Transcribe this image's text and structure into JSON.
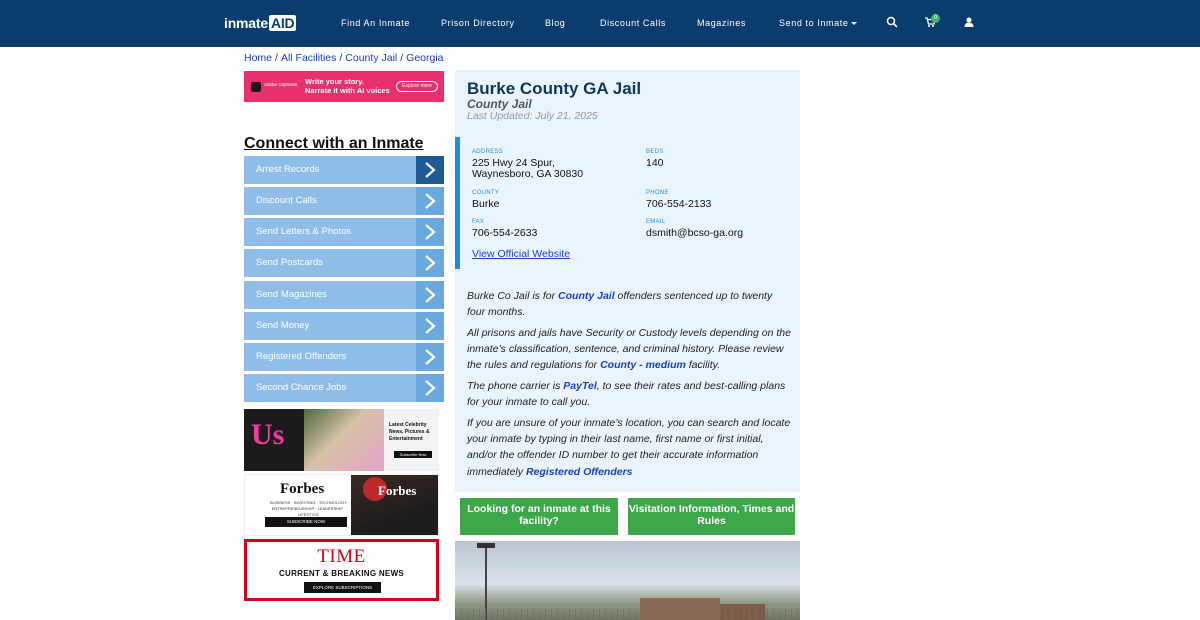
{
  "nav": {
    "logo_main": "inmate",
    "logo_accent": "AID",
    "links": [
      "Find An Inmate",
      "Prison Directory",
      "Blog",
      "Discount Calls",
      "Magazines",
      "Send to Inmate"
    ],
    "cart_count": "0",
    "icons": [
      "search-icon",
      "cart-icon",
      "user-icon"
    ]
  },
  "breadcrumb": [
    "Home",
    "All Facilities",
    "County Jail",
    "Georgia"
  ],
  "ads": {
    "adobe": {
      "brand": "Adobe Captivate",
      "line1": "Write your story.",
      "line2": "Narrate it with AI voices",
      "cta": "Explore more"
    },
    "us": {
      "logo": "Us",
      "text": "Latest Celebrity News, Pictures & Entertainment",
      "cta": "Subscribe Now"
    },
    "forbes": {
      "logo": "Forbes",
      "tagline": "BUSINESS · INVESTING · TECHNOLOGY ENTREPRENEURSHIP · LEADERSHIP · LIFESTYLE",
      "cta": "SUBSCRIBE NOW",
      "cover_logo": "Forbes"
    },
    "time": {
      "logo": "TIME",
      "subtitle": "CURRENT & BREAKING NEWS",
      "cta": "EXPLORE SUBSCRIPTIONS"
    }
  },
  "sidebar": {
    "title": "Connect with an Inmate",
    "items": [
      "Arrest Records",
      "Discount Calls",
      "Send Letters & Photos",
      "Send Postcards",
      "Send Magazines",
      "Send Money",
      "Registered Offenders",
      "Second Chance Jobs"
    ]
  },
  "facility": {
    "title": "Burke County GA Jail",
    "type": "County Jail",
    "updated": "Last Updated: July 21, 2025",
    "fields": {
      "address_label": "ADDRESS",
      "address_line1": "225 Hwy 24 Spur,",
      "address_line2": "Waynesboro, GA 30830",
      "beds_label": "BEDS",
      "beds": "140",
      "county_label": "COUNTY",
      "county": "Burke",
      "phone_label": "PHONE",
      "phone": "706-554-2133",
      "fax_label": "FAX",
      "fax": "706-554-2633",
      "email_label": "EMAIL",
      "email": "dsmith@bcso-ga.org"
    },
    "website_link": "View Official Website"
  },
  "description": {
    "p1_a": "Burke Co Jail is for ",
    "p1_link": "County Jail",
    "p1_b": " offenders sentenced up to twenty four months.",
    "p2_a": "All prisons and jails have Security or Custody levels depending on the inmate’s classification, sentence, and criminal history. Please review the rules and regulations for ",
    "p2_link": "County - medium",
    "p2_b": " facility.",
    "p3_a": "The phone carrier is ",
    "p3_link": "PayTel",
    "p3_b": ", to see their rates and best-calling plans for your inmate to call you.",
    "p4_a": "If you are unsure of your inmate’s location, you can search and locate your inmate by typing in their last name, first name or first initial, and/or the offender ID number to get their accurate information immediately ",
    "p4_link": "Registered Offenders"
  },
  "buttons": {
    "find_inmate": "Looking for an inmate at this facility?",
    "visitation": "Visitation Information, Times and Rules"
  },
  "colors": {
    "navbar": "#0a3d6e",
    "menu_item": "#8fbde8",
    "accent_link": "#1a3fbf",
    "green_button": "#3ca84a",
    "panel_bg": "#eaf4fc"
  }
}
